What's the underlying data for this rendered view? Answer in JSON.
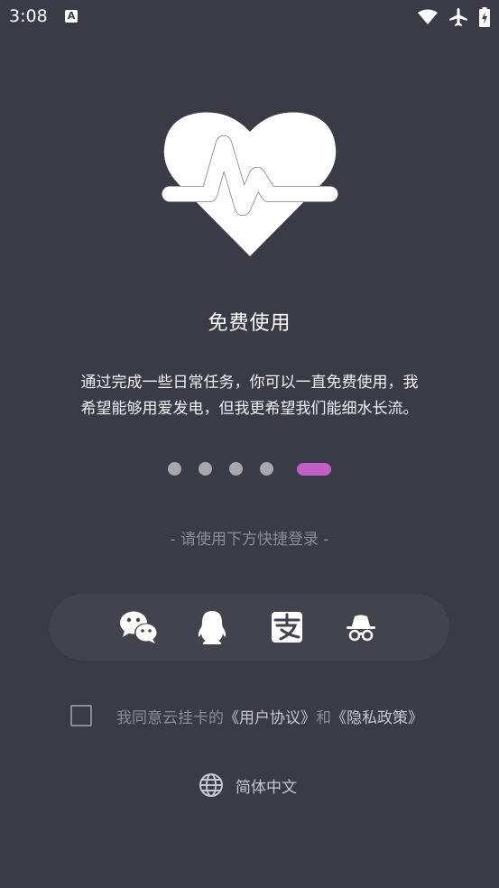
{
  "status_bar": {
    "time": "3:08",
    "notification_icon": "A",
    "icons": [
      "wifi-icon",
      "airplane-icon",
      "battery-charging-icon"
    ]
  },
  "hero": {
    "icon": "heart-pulse-icon"
  },
  "onboarding": {
    "title": "免费使用",
    "description_line1": "通过完成一些日常任务，你可以一直免费使用，我",
    "description_line2": "希望能够用爱发电，但我更希望我们能细水长流。",
    "page_count": 5,
    "active_page": 5
  },
  "login": {
    "hint": "- 请使用下方快捷登录 -",
    "methods": [
      "wechat-icon",
      "qq-icon",
      "alipay-icon",
      "incognito-icon"
    ]
  },
  "agreement": {
    "prefix": "我同意云挂卡的",
    "user_agreement": "《用户协议》",
    "and": "和",
    "privacy_policy": "《隐私政策》",
    "checked": false
  },
  "language": {
    "label": "简体中文",
    "icon": "globe-icon"
  },
  "colors": {
    "background": "#3b3a47",
    "accent": "#c25fc6",
    "dot_inactive": "#a9a8ae",
    "muted_text": "#8d8c96"
  }
}
